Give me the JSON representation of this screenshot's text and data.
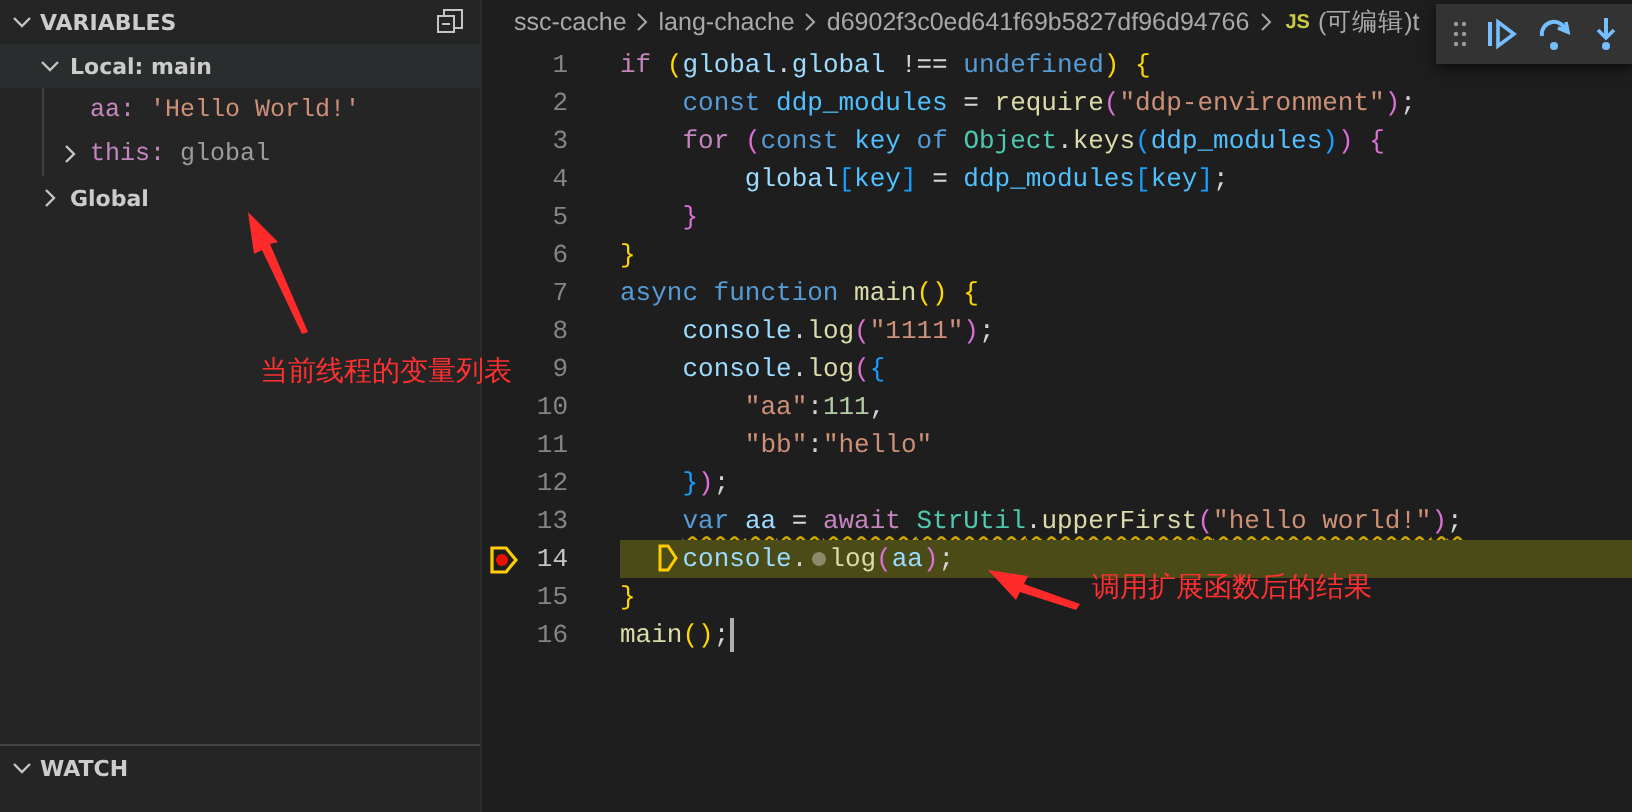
{
  "sidebar": {
    "variables": {
      "title": "VARIABLES",
      "expanded": true,
      "scopes": [
        {
          "label": "Local: main",
          "expanded": true,
          "children": [
            {
              "name": "aa:",
              "value": "'Hello World!'",
              "kind": "string"
            },
            {
              "name": "this:",
              "value": "global",
              "kind": "object",
              "expanded": false
            }
          ]
        },
        {
          "label": "Global",
          "expanded": false
        }
      ]
    },
    "watch": {
      "title": "WATCH",
      "expanded": true
    }
  },
  "breadcrumb": {
    "segments": [
      "ssc-cache",
      "lang-chache",
      "d6902f3c0ed641f69b5827df96d94766"
    ],
    "file_icon": "JS",
    "file": "(可编辑)t"
  },
  "debug_toolbar": {
    "buttons": [
      {
        "kind": "continue"
      },
      {
        "kind": "step-over"
      },
      {
        "kind": "step-into"
      }
    ]
  },
  "code": [
    {
      "number": "1",
      "tokens": [
        {
          "kind": "kw",
          "text": "if "
        },
        {
          "kind": "b1",
          "text": "("
        },
        {
          "kind": "var",
          "text": "global"
        },
        {
          "kind": "plain",
          "text": "."
        },
        {
          "kind": "var",
          "text": "global"
        },
        {
          "kind": "plain",
          "text": " !== "
        },
        {
          "kind": "st",
          "text": "undefined"
        },
        {
          "kind": "b1",
          "text": ")"
        },
        {
          "kind": "b1",
          "text": " {"
        }
      ]
    },
    {
      "number": "2",
      "tokens": [
        {
          "kind": "st",
          "text": "    const "
        },
        {
          "kind": "const",
          "text": "ddp_modules"
        },
        {
          "kind": "plain",
          "text": " = "
        },
        {
          "kind": "fn",
          "text": "require"
        },
        {
          "kind": "b2",
          "text": "("
        },
        {
          "kind": "str",
          "text": "\"ddp-environment\""
        },
        {
          "kind": "b2",
          "text": ")"
        },
        {
          "kind": "plain",
          "text": ";"
        }
      ]
    },
    {
      "number": "3",
      "tokens": [
        {
          "kind": "kw",
          "text": "    for "
        },
        {
          "kind": "b2",
          "text": "("
        },
        {
          "kind": "st",
          "text": "const "
        },
        {
          "kind": "const",
          "text": "key "
        },
        {
          "kind": "st",
          "text": "of "
        },
        {
          "kind": "cls",
          "text": "Object"
        },
        {
          "kind": "plain",
          "text": "."
        },
        {
          "kind": "fn",
          "text": "keys"
        },
        {
          "kind": "b3",
          "text": "("
        },
        {
          "kind": "const",
          "text": "ddp_modules"
        },
        {
          "kind": "b3",
          "text": ")"
        },
        {
          "kind": "b2",
          "text": ")"
        },
        {
          "kind": "b2",
          "text": " {"
        }
      ]
    },
    {
      "number": "4",
      "tokens": [
        {
          "kind": "var",
          "text": "        global"
        },
        {
          "kind": "b3",
          "text": "["
        },
        {
          "kind": "const",
          "text": "key"
        },
        {
          "kind": "b3",
          "text": "]"
        },
        {
          "kind": "plain",
          "text": " = "
        },
        {
          "kind": "const",
          "text": "ddp_modules"
        },
        {
          "kind": "b3",
          "text": "["
        },
        {
          "kind": "const",
          "text": "key"
        },
        {
          "kind": "b3",
          "text": "]"
        },
        {
          "kind": "plain",
          "text": ";"
        }
      ]
    },
    {
      "number": "5",
      "tokens": [
        {
          "kind": "b2",
          "text": "    }"
        }
      ]
    },
    {
      "number": "6",
      "tokens": [
        {
          "kind": "b1",
          "text": "}"
        }
      ]
    },
    {
      "number": "7",
      "tokens": [
        {
          "kind": "st",
          "text": "async function "
        },
        {
          "kind": "fn",
          "text": "main"
        },
        {
          "kind": "b1",
          "text": "()"
        },
        {
          "kind": "b1",
          "text": " {"
        }
      ]
    },
    {
      "number": "8",
      "tokens": [
        {
          "kind": "var",
          "text": "    console"
        },
        {
          "kind": "plain",
          "text": "."
        },
        {
          "kind": "fn",
          "text": "log"
        },
        {
          "kind": "b2",
          "text": "("
        },
        {
          "kind": "str",
          "text": "\"1111\""
        },
        {
          "kind": "b2",
          "text": ")"
        },
        {
          "kind": "plain",
          "text": ";"
        }
      ]
    },
    {
      "number": "9",
      "tokens": [
        {
          "kind": "var",
          "text": "    console"
        },
        {
          "kind": "plain",
          "text": "."
        },
        {
          "kind": "fn",
          "text": "log"
        },
        {
          "kind": "b2",
          "text": "("
        },
        {
          "kind": "b3",
          "text": "{"
        }
      ]
    },
    {
      "number": "10",
      "tokens": [
        {
          "kind": "str",
          "text": "        \"aa\""
        },
        {
          "kind": "plain",
          "text": ":"
        },
        {
          "kind": "num",
          "text": "111"
        },
        {
          "kind": "plain",
          "text": ","
        }
      ]
    },
    {
      "number": "11",
      "tokens": [
        {
          "kind": "str",
          "text": "        \"bb\""
        },
        {
          "kind": "plain",
          "text": ":"
        },
        {
          "kind": "str",
          "text": "\"hello\""
        }
      ]
    },
    {
      "number": "12",
      "tokens": [
        {
          "kind": "b3",
          "text": "    }"
        },
        {
          "kind": "b2",
          "text": ")"
        },
        {
          "kind": "plain",
          "text": ";"
        }
      ]
    },
    {
      "number": "13",
      "warning": true,
      "tokens": [
        {
          "kind": "st",
          "text": "    var "
        },
        {
          "kind": "var",
          "text": "aa"
        },
        {
          "kind": "plain",
          "text": " = "
        },
        {
          "kind": "kw",
          "text": "await "
        },
        {
          "kind": "cls",
          "text": "StrUtil"
        },
        {
          "kind": "plain",
          "text": "."
        },
        {
          "kind": "fn",
          "text": "upperFirst"
        },
        {
          "kind": "b2",
          "text": "("
        },
        {
          "kind": "str",
          "text": "\"hello world!\""
        },
        {
          "kind": "b2",
          "text": ")"
        },
        {
          "kind": "plain",
          "text": ";"
        }
      ]
    },
    {
      "number": "14",
      "current": true,
      "tokens": [
        {
          "kind": "var",
          "text": "    console"
        },
        {
          "kind": "plain",
          "text": "."
        },
        {
          "kind": "column-breakpoint"
        },
        {
          "kind": "fn",
          "text": "log"
        },
        {
          "kind": "b2",
          "text": "("
        },
        {
          "kind": "var",
          "text": "aa"
        },
        {
          "kind": "b2",
          "text": ")"
        },
        {
          "kind": "plain",
          "text": ";"
        }
      ]
    },
    {
      "number": "15",
      "tokens": [
        {
          "kind": "b1",
          "text": "}"
        }
      ]
    },
    {
      "number": "16",
      "cursor": true,
      "tokens": [
        {
          "kind": "fn",
          "text": "main"
        },
        {
          "kind": "b1",
          "text": "()"
        },
        {
          "kind": "plain",
          "text": ";"
        }
      ]
    }
  ],
  "annotations": [
    {
      "kind": "variables-note",
      "text": "当前线程的变量列表"
    },
    {
      "kind": "result-note",
      "text": "调用扩展函数后的结果"
    }
  ]
}
